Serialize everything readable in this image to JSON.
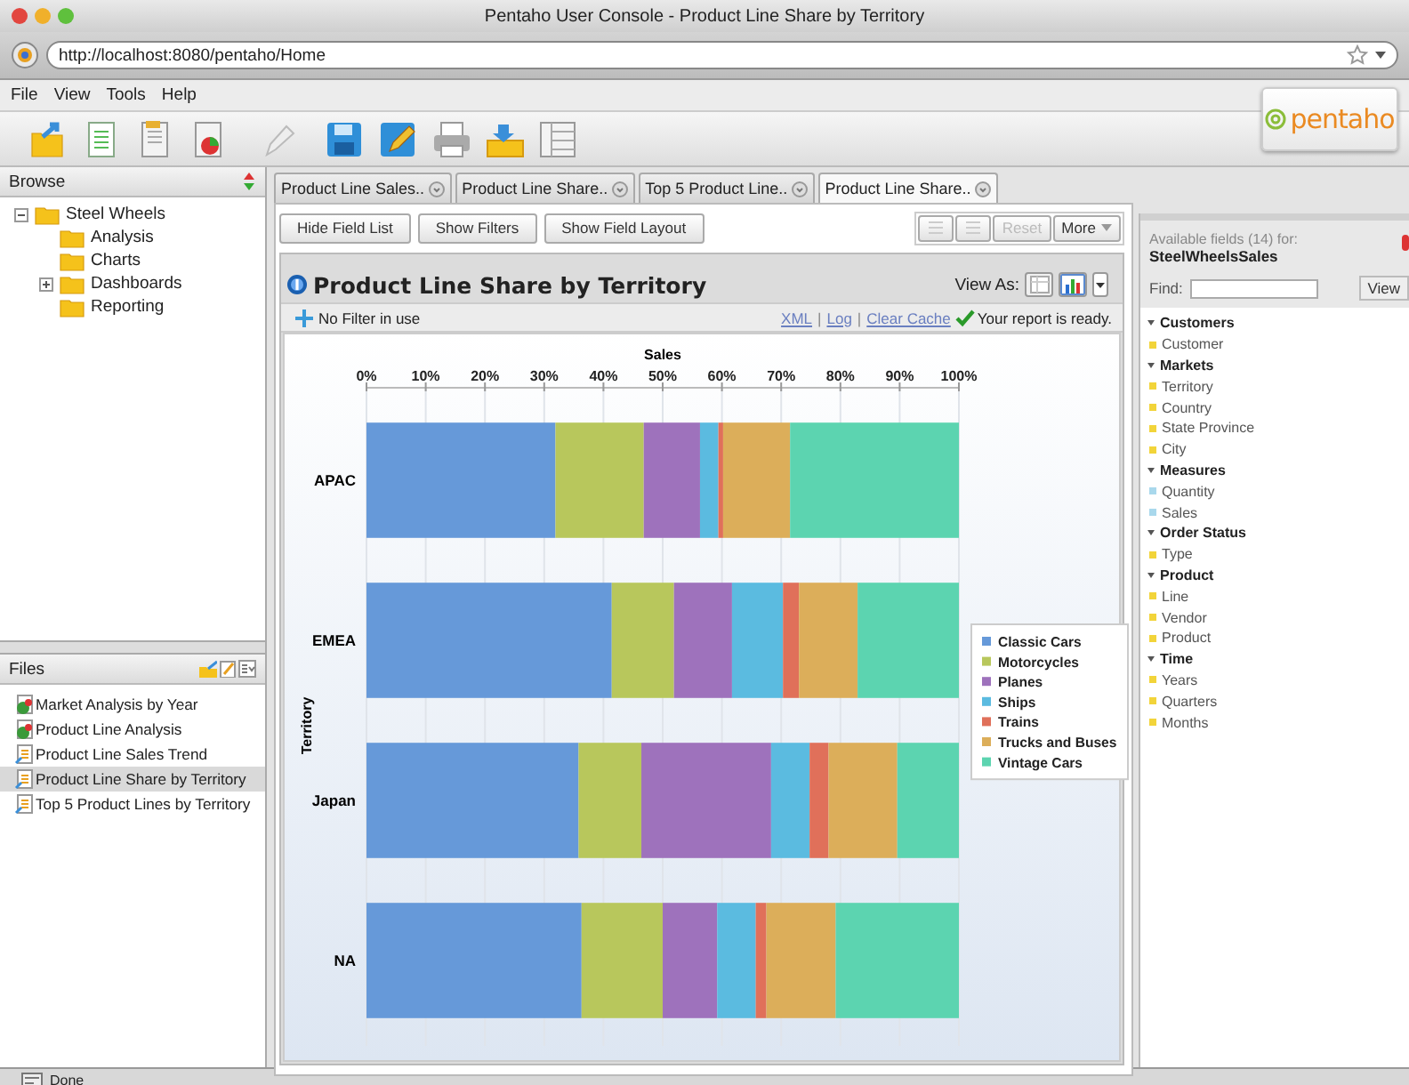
{
  "window": {
    "title": "Pentaho User Console - Product Line Share by Territory",
    "url": "http://localhost:8080/pentaho/Home"
  },
  "menu": [
    "File",
    "View",
    "Tools",
    "Help"
  ],
  "logo": "pentaho",
  "browse": {
    "title": "Browse",
    "tree": [
      {
        "label": "Steel Wheels",
        "expanded": true,
        "children": [
          {
            "label": "Analysis"
          },
          {
            "label": "Charts"
          },
          {
            "label": "Dashboards",
            "expanded": false
          },
          {
            "label": "Reporting"
          }
        ]
      }
    ]
  },
  "files": {
    "title": "Files",
    "items": [
      {
        "label": "Market Analysis by Year",
        "kind": "analysis",
        "selected": false
      },
      {
        "label": "Product Line Analysis",
        "kind": "analysis",
        "selected": false
      },
      {
        "label": "Product Line Sales Trend",
        "kind": "report",
        "selected": false
      },
      {
        "label": "Product Line Share by Territory",
        "kind": "report",
        "selected": true
      },
      {
        "label": "Top 5 Product Lines by Territory",
        "kind": "report",
        "selected": false
      }
    ]
  },
  "tabs": [
    {
      "label": "Product Line Sales..",
      "selected": false
    },
    {
      "label": "Product Line Share..",
      "selected": false
    },
    {
      "label": "Top 5 Product Line..",
      "selected": false
    },
    {
      "label": "Product Line Share..",
      "selected": true
    }
  ],
  "report_buttons": [
    "Hide Field List",
    "Show Filters",
    "Show Field Layout"
  ],
  "report_actions": [
    {
      "kind": "icon",
      "disabled": true
    },
    {
      "kind": "icon",
      "disabled": true
    },
    {
      "kind": "text",
      "label": "Reset",
      "disabled": true
    },
    {
      "kind": "menu",
      "label": "More",
      "disabled": false
    }
  ],
  "report": {
    "title": "Product Line Share by Territory",
    "view_as_label": "View As:",
    "view_as": [
      {
        "kind": "table",
        "selected": false
      },
      {
        "kind": "chart",
        "selected": true
      }
    ],
    "filter_text": "No Filter in use",
    "links": [
      "XML",
      "Log",
      "Clear Cache"
    ],
    "link_separator": "|",
    "status": "Your report is ready.",
    "chart_data": {
      "type": "bar",
      "orientation": "horizontal",
      "stacked": true,
      "grid": true,
      "legend": true,
      "xlabel": "Sales",
      "ylabel": "Territory",
      "categories": [
        "APAC",
        "EMEA",
        "Japan",
        "NA"
      ],
      "xlim": [
        0,
        100
      ],
      "xticks": [
        {
          "value": 0,
          "label": "0%"
        },
        {
          "value": 10,
          "label": "10%"
        },
        {
          "value": 20,
          "label": "20%"
        },
        {
          "value": 30,
          "label": "30%"
        },
        {
          "value": 40,
          "label": "40%"
        },
        {
          "value": 50,
          "label": "50%"
        },
        {
          "value": 60,
          "label": "60%"
        },
        {
          "value": 70,
          "label": "70%"
        },
        {
          "value": 80,
          "label": "80%"
        },
        {
          "value": 90,
          "label": "90%"
        },
        {
          "value": 100,
          "label": "100%"
        }
      ],
      "series": [
        {
          "name": "Classic Cars",
          "color": "#6699d9",
          "values": [
            31.9,
            41.4,
            35.8,
            36.3
          ]
        },
        {
          "name": "Motorcycles",
          "color": "#b8c75c",
          "values": [
            14.9,
            10.5,
            10.6,
            13.7
          ]
        },
        {
          "name": "Planes",
          "color": "#9e72bc",
          "values": [
            9.5,
            9.8,
            21.9,
            9.2
          ]
        },
        {
          "name": "Ships",
          "color": "#5bbbe0",
          "values": [
            3.1,
            8.6,
            6.5,
            6.5
          ]
        },
        {
          "name": "Trains",
          "color": "#e0705a",
          "values": [
            0.8,
            2.7,
            3.2,
            1.8
          ]
        },
        {
          "name": "Trucks and Buses",
          "color": "#dcae5a",
          "values": [
            11.3,
            9.9,
            11.6,
            11.7
          ]
        },
        {
          "name": "Vintage Cars",
          "color": "#5cd4b0",
          "values": [
            28.5,
            17.1,
            10.4,
            20.8
          ]
        }
      ]
    }
  },
  "fields": {
    "caption": "Available fields (14) for:",
    "cube": "SteelWheelsSales",
    "find_label": "Find:",
    "view_button": "View",
    "groups": [
      {
        "label": "Customers",
        "items": [
          {
            "label": "Customer",
            "color": "#f2d43a"
          }
        ]
      },
      {
        "label": "Markets",
        "items": [
          {
            "label": "Territory",
            "color": "#f2d43a"
          },
          {
            "label": "Country",
            "color": "#f2d43a"
          },
          {
            "label": "State Province",
            "color": "#f2d43a"
          },
          {
            "label": "City",
            "color": "#f2d43a"
          }
        ]
      },
      {
        "label": "Measures",
        "items": [
          {
            "label": "Quantity",
            "color": "#a9d8ec"
          },
          {
            "label": "Sales",
            "color": "#a9d8ec"
          }
        ]
      },
      {
        "label": "Order Status",
        "items": [
          {
            "label": "Type",
            "color": "#f2d43a"
          }
        ]
      },
      {
        "label": "Product",
        "items": [
          {
            "label": "Line",
            "color": "#f2d43a"
          },
          {
            "label": "Vendor",
            "color": "#f2d43a"
          },
          {
            "label": "Product",
            "color": "#f2d43a"
          }
        ]
      },
      {
        "label": "Time",
        "items": [
          {
            "label": "Years",
            "color": "#f2d43a"
          },
          {
            "label": "Quarters",
            "color": "#f2d43a"
          },
          {
            "label": "Months",
            "color": "#f2d43a"
          }
        ]
      }
    ]
  },
  "status_bar": "Done"
}
